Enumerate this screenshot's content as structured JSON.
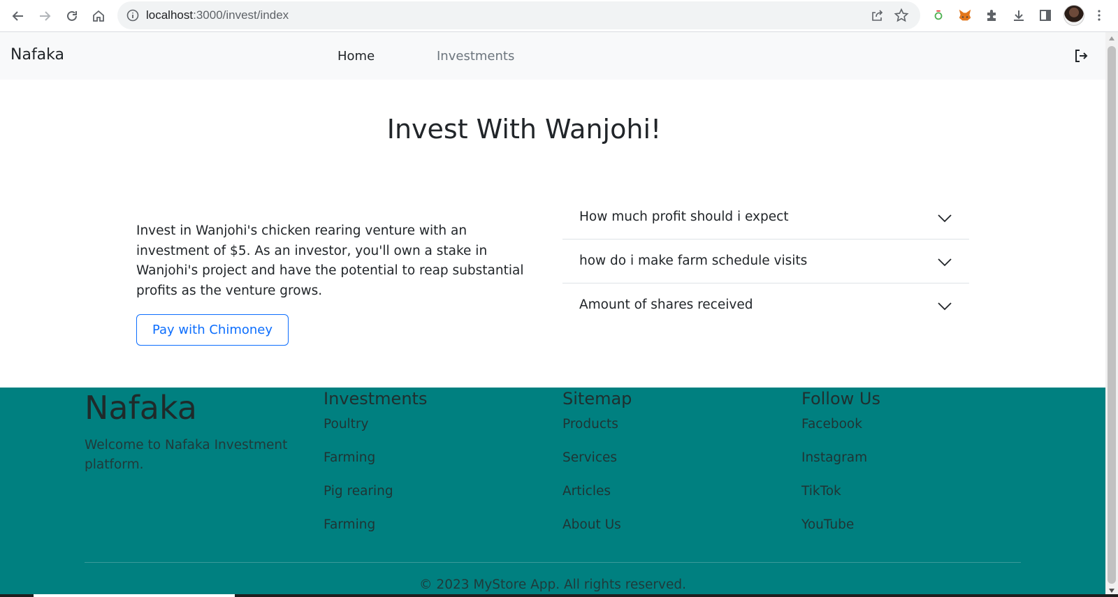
{
  "browser": {
    "url_host": "localhost",
    "url_path": ":3000/invest/index"
  },
  "navbar": {
    "brand": "Nafaka",
    "links": [
      "Home",
      "Investments"
    ]
  },
  "hero": {
    "title": "Invest With Wanjohi!",
    "description": "Invest in Wanjohi's chicken rearing venture with an investment of $5. As an investor, you'll own a stake in Wanjohi's project and have the potential to reap substantial profits as the venture grows.",
    "pay_button": "Pay with Chimoney"
  },
  "faq": [
    "How much profit should i expect",
    "how do i make farm schedule visits",
    "Amount of shares received"
  ],
  "footer": {
    "brand": "Nafaka",
    "tagline": "Welcome to Nafaka Investment platform.",
    "columns": [
      {
        "heading": "Investments",
        "links": [
          "Poultry",
          "Farming",
          "Pig rearing",
          "Farming"
        ]
      },
      {
        "heading": "Sitemap",
        "links": [
          "Products",
          "Services",
          "Articles",
          "About Us"
        ]
      },
      {
        "heading": "Follow Us",
        "links": [
          "Facebook",
          "Instagram",
          "TikTok",
          "YouTube"
        ]
      }
    ],
    "copyright": "© 2023 MyStore App. All rights reserved.",
    "background_color": "#008080"
  }
}
